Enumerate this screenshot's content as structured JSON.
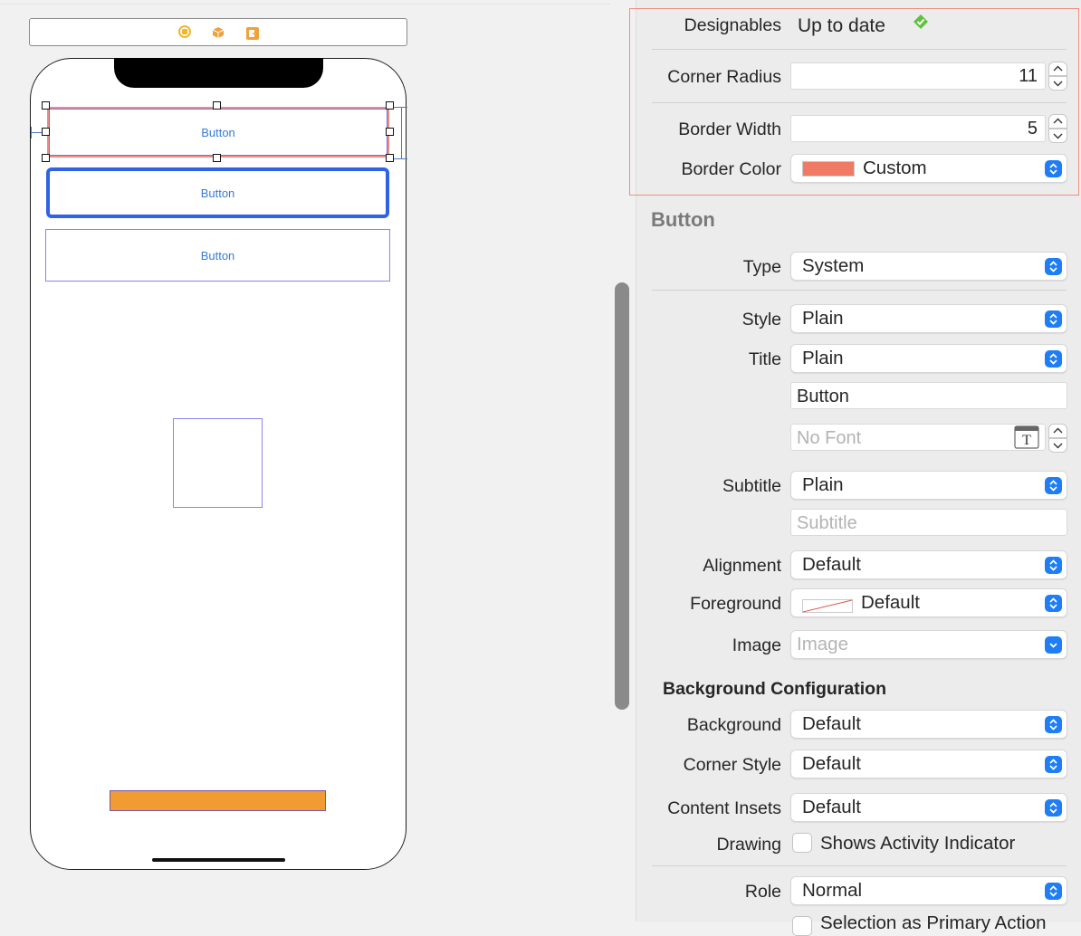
{
  "canvas": {
    "buttons": [
      "Button",
      "Button",
      "Button"
    ]
  },
  "inspector": {
    "designables": {
      "label": "Designables",
      "value": "Up to date"
    },
    "corner_radius": {
      "label": "Corner Radius",
      "value": "11"
    },
    "border_width": {
      "label": "Border Width",
      "value": "5"
    },
    "border_color": {
      "label": "Border Color",
      "value": "Custom",
      "swatch": "#f07b64"
    },
    "button_section": "Button",
    "type": {
      "label": "Type",
      "value": "System"
    },
    "style": {
      "label": "Style",
      "value": "Plain"
    },
    "title": {
      "label": "Title",
      "value": "Plain",
      "text": "Button",
      "font_placeholder": "No Font"
    },
    "subtitle": {
      "label": "Subtitle",
      "value": "Plain",
      "placeholder": "Subtitle"
    },
    "alignment": {
      "label": "Alignment",
      "value": "Default"
    },
    "foreground": {
      "label": "Foreground",
      "value": "Default"
    },
    "image": {
      "label": "Image",
      "placeholder": "Image"
    },
    "background_config": "Background Configuration",
    "background": {
      "label": "Background",
      "value": "Default"
    },
    "corner_style": {
      "label": "Corner Style",
      "value": "Default"
    },
    "content_insets": {
      "label": "Content Insets",
      "value": "Default"
    },
    "drawing": {
      "label": "Drawing",
      "checkbox_label": "Shows Activity Indicator",
      "checked": false
    },
    "role": {
      "label": "Role",
      "value": "Normal"
    },
    "next_row_label": "Selection as Primary Action"
  },
  "colors": {
    "accent": "#1f7ef5",
    "highlight": "#ee8e7e",
    "orange_bar": "#f19b33",
    "check_green": "#5cc13b"
  }
}
